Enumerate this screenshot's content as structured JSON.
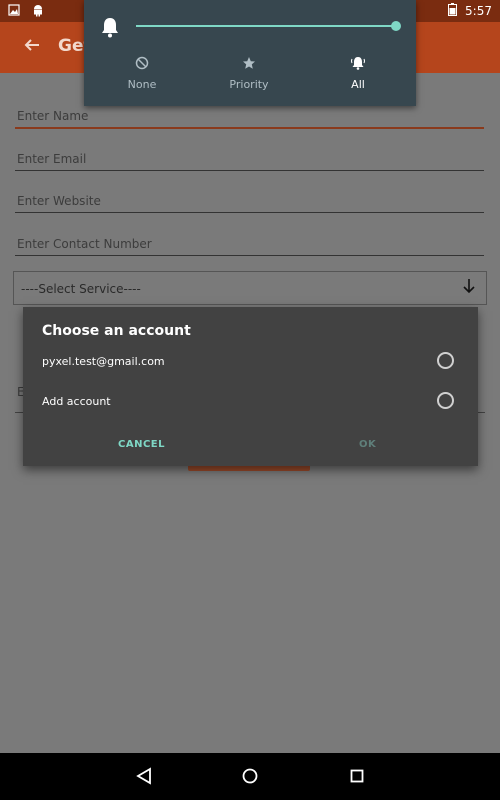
{
  "status_bar": {
    "time": "5:57",
    "icons": [
      "image-icon",
      "android-icon",
      "battery-icon"
    ]
  },
  "app_bar": {
    "back_icon": "back-arrow-icon",
    "title": "Get"
  },
  "form": {
    "name_placeholder": "Enter Name",
    "email_placeholder": "Enter Email",
    "website_placeholder": "Enter Website",
    "contact_placeholder": "Enter Contact Number",
    "service_select": "----Select Service----",
    "partial_field_label": "E"
  },
  "volume_panel": {
    "level": 1.0,
    "modes": [
      {
        "label": "None",
        "icon": "none-icon",
        "active": false
      },
      {
        "label": "Priority",
        "icon": "star-icon",
        "active": false
      },
      {
        "label": "All",
        "icon": "bell-all-icon",
        "active": true
      }
    ]
  },
  "dialog": {
    "title": "Choose an account",
    "accounts": [
      {
        "label": "pyxel.test@gmail.com"
      },
      {
        "label": "Add account"
      }
    ],
    "cancel_label": "CANCEL",
    "ok_label": "OK"
  },
  "colors": {
    "accent": "#7fd8c6",
    "app_bar": "#b5451c",
    "dialog_bg": "#424242",
    "panel_bg": "#37474f"
  }
}
